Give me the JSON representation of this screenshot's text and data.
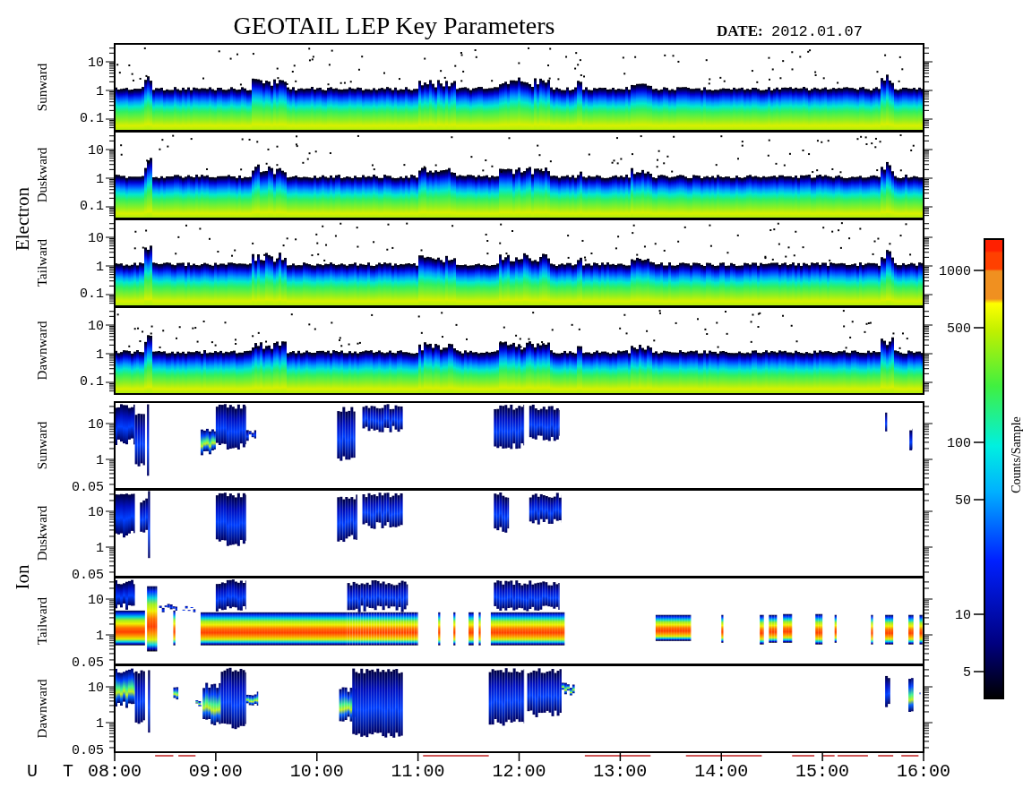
{
  "title": "GEOTAIL LEP Key Parameters",
  "date_label": "DATE:",
  "date": "2012.01.07",
  "groups": [
    {
      "label": "Electron",
      "panels": [
        {
          "label": "Sunward",
          "yticks": [
            "10",
            "1",
            "0.1"
          ]
        },
        {
          "label": "Duskward",
          "yticks": [
            "10",
            "1",
            "0.1"
          ]
        },
        {
          "label": "Tailward",
          "yticks": [
            "10",
            "1",
            "0.1"
          ]
        },
        {
          "label": "Dawnward",
          "yticks": [
            "10",
            "1",
            "0.1"
          ]
        }
      ]
    },
    {
      "label": "Ion",
      "panels": [
        {
          "label": "Sunward",
          "yticks": [
            "10",
            "1",
            "0.05"
          ]
        },
        {
          "label": "Duskward",
          "yticks": [
            "10",
            "1",
            "0.05"
          ]
        },
        {
          "label": "Tailward",
          "yticks": [
            "10",
            "1",
            "0.05"
          ]
        },
        {
          "label": "Dawnward",
          "yticks": [
            "10",
            "1",
            "0.05"
          ]
        }
      ]
    }
  ],
  "colorbar": {
    "label": "Counts/Sample",
    "ticks": [
      "1000",
      "500",
      "100",
      "50",
      "10",
      "5"
    ]
  },
  "time_axis": {
    "label": "U T",
    "ticks": [
      "08:00",
      "09:00",
      "10:00",
      "11:00",
      "12:00",
      "13:00",
      "14:00",
      "15:00",
      "16:00"
    ]
  }
}
